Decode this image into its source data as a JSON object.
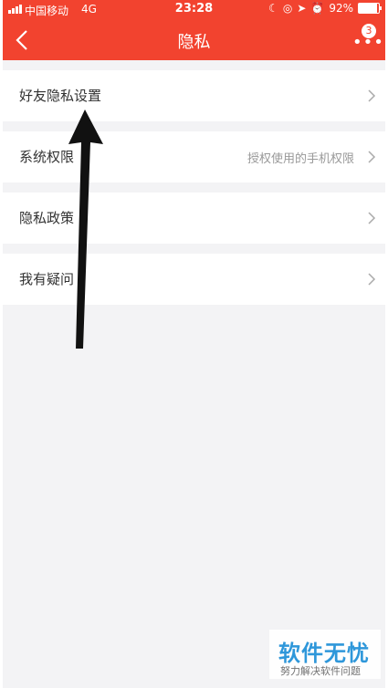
{
  "status_bar": {
    "carrier": "中国移动",
    "network": "4G",
    "time": "23:28",
    "battery": "92%",
    "battery_fraction": 0.92
  },
  "nav": {
    "title": "隐私",
    "more_badge": "3"
  },
  "rows": [
    {
      "label": "好友隐私设置",
      "hint": ""
    },
    {
      "label": "系统权限",
      "hint": "授权使用的手机权限"
    },
    {
      "label": "隐私政策",
      "hint": ""
    },
    {
      "label": "我有疑问",
      "hint": ""
    }
  ],
  "watermark": {
    "title": "软件无忧",
    "subtitle": "努力解决软件问题"
  },
  "colors": {
    "header": "#f2432f",
    "background": "#f3f3f5",
    "watermark_blue": "#1e90d8"
  }
}
